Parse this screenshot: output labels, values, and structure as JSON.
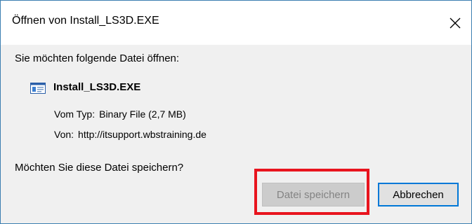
{
  "window": {
    "title": "Öffnen von Install_LS3D.EXE",
    "close_icon": "close-icon"
  },
  "dialog": {
    "prompt": "Sie möchten folgende Datei öffnen:",
    "file": {
      "icon": "executable-file-icon",
      "name": "Install_LS3D.EXE"
    },
    "type_label": "Vom Typ:",
    "type_value": "Binary File (2,7 MB)",
    "from_label": "Von:",
    "from_value": "http://itsupport.wbstraining.de",
    "question": "Möchten Sie diese Datei speichern?"
  },
  "buttons": {
    "save_label": "Datei speichern",
    "save_disabled": true,
    "cancel_label": "Abbrechen"
  },
  "colors": {
    "window_border": "#3c7fb1",
    "dialog_bg": "#f0f0f0",
    "focus_blue": "#0078d7",
    "highlight_red": "#e8141e",
    "disabled_text": "#838383"
  }
}
